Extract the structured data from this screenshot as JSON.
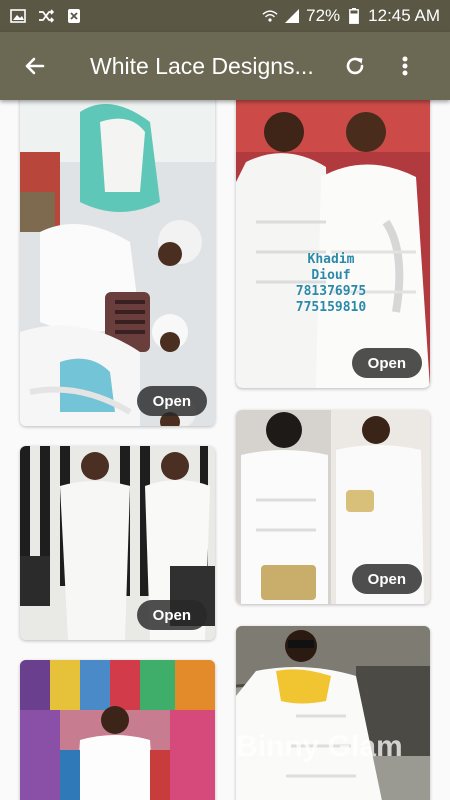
{
  "status_bar": {
    "left_icons": [
      "image-icon",
      "shuffle-icon",
      "close-box-icon"
    ],
    "battery": "72%",
    "time": "12:45 AM"
  },
  "app_bar": {
    "title": "White Lace Designs...",
    "back_icon": "arrow-left-icon",
    "refresh_icon": "refresh-icon",
    "menu_icon": "more-vert-icon"
  },
  "grid": {
    "open_label": "Open",
    "cards": [
      {
        "id": "card-1",
        "overlay": []
      },
      {
        "id": "card-2",
        "overlay": [
          "Khadim",
          "Diouf",
          "781376975",
          "775159810"
        ]
      },
      {
        "id": "card-3",
        "overlay": []
      },
      {
        "id": "card-4",
        "overlay": []
      },
      {
        "id": "card-5",
        "overlay": []
      },
      {
        "id": "card-6",
        "watermark": "Binny Glam"
      }
    ]
  },
  "colors": {
    "status_bar": "#5a5744",
    "app_bar": "#6b6853",
    "open_button": "#282828"
  }
}
